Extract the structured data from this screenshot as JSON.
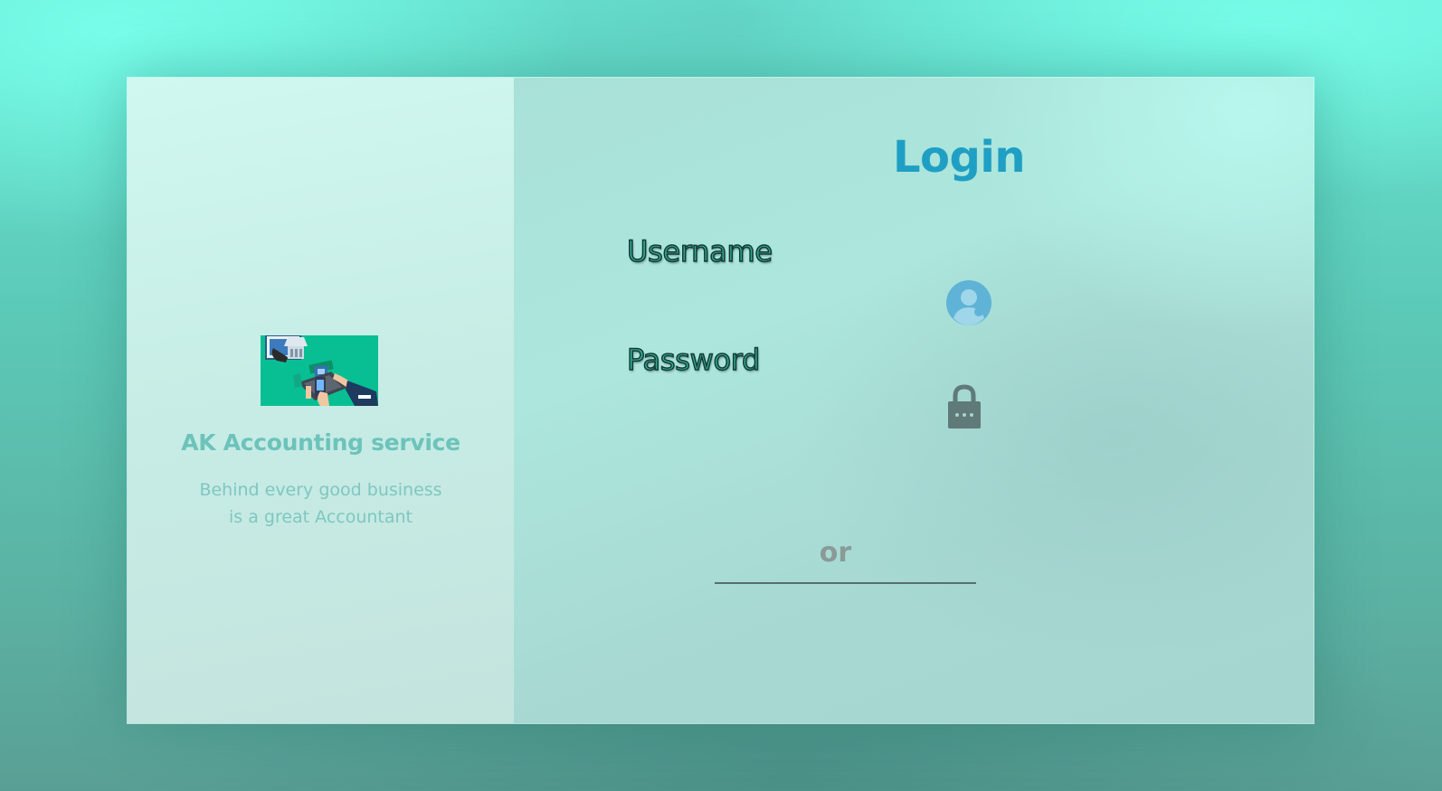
{
  "brand": {
    "name": "AK Accounting service",
    "tagline_line1": "Behind every good business",
    "tagline_line2": "is a great Accountant",
    "logo_icon": "accounting-illustration-icon"
  },
  "login": {
    "title": "Login",
    "username_label": "Username",
    "password_label": "Password",
    "username_value": "",
    "password_value": "",
    "username_icon": "user-avatar-icon",
    "password_icon": "lock-icon",
    "divider_text": "or"
  },
  "colors": {
    "accent": "#1f9fc4",
    "brand_text": "#6cc3bb",
    "logo_background": "#08bf93",
    "background": "#5cc9b7"
  }
}
